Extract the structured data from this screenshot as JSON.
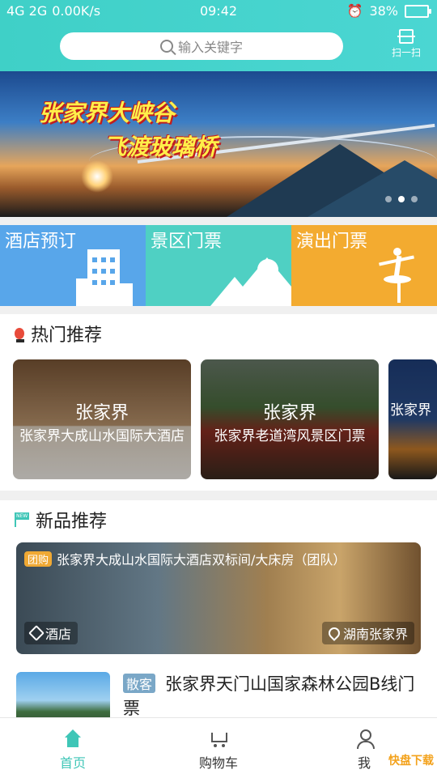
{
  "status": {
    "network": "4G 2G",
    "speed": "0.00K/s",
    "time": "09:42",
    "battery": "38%",
    "battery_level": 0.38
  },
  "header": {
    "search_placeholder": "输入关键字",
    "scan_label": "扫一扫"
  },
  "banner": {
    "title_line1": "张家界大峡谷",
    "title_line2": "飞渡玻璃桥",
    "dots": 3,
    "active_dot": 2
  },
  "categories": [
    {
      "label": "酒店预订",
      "icon": "hotel-building-icon",
      "color": "#58a6ea"
    },
    {
      "label": "景区门票",
      "icon": "mountain-icon",
      "color": "#4fd0c3"
    },
    {
      "label": "演出门票",
      "icon": "dancer-icon",
      "color": "#f3ab30"
    }
  ],
  "hot": {
    "title": "热门推荐",
    "cards": [
      {
        "city": "张家界",
        "name": "张家界大成山水国际大酒店"
      },
      {
        "city": "张家界",
        "name": "张家界老道湾风景区门票"
      },
      {
        "city": "",
        "name": "张家界"
      }
    ]
  },
  "new": {
    "title": "新品推荐",
    "item1": {
      "badge": "团购",
      "title": "张家界大成山水国际大酒店双标间/大床房（团队）",
      "category": "酒店",
      "location": "湖南张家界"
    },
    "item2": {
      "badge": "散客",
      "title": "张家界天门山国家森林公园B线门票"
    }
  },
  "tabs": [
    {
      "label": "首页",
      "active": true
    },
    {
      "label": "购物车",
      "active": false
    },
    {
      "label": "我",
      "active": false
    }
  ],
  "watermark": "快盘下载"
}
